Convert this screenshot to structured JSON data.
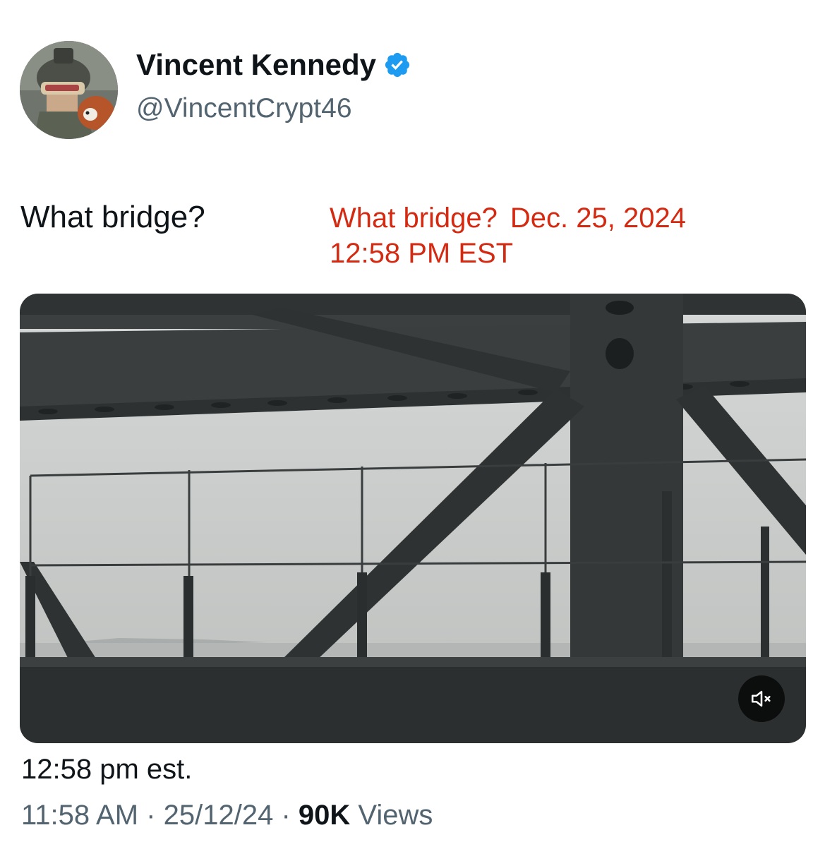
{
  "author": {
    "display_name": "Vincent Kennedy",
    "handle": "@VincentCrypt46",
    "verified_color": "#1d9bf0"
  },
  "tweet": {
    "text": "What bridge?",
    "caption": "12:58 pm est."
  },
  "annotation": {
    "line1_a": "What bridge?",
    "line1_b": "Dec. 25, 2024",
    "line2": "12:58 PM EST",
    "color": "#d42a12"
  },
  "media": {
    "type": "video",
    "mute_icon": "speaker-muted-icon"
  },
  "meta": {
    "time": "11:58 AM",
    "separator": "·",
    "date": "25/12/24",
    "views_count": "90K",
    "views_label": "Views"
  }
}
